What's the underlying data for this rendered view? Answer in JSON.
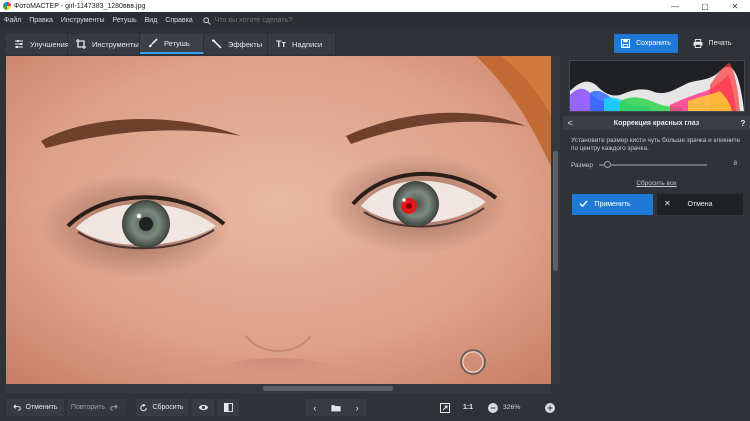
{
  "window": {
    "title": "ФотоМАСТЕР - girl-1147383_1280ввв.jpg",
    "controls": [
      "—",
      "▢",
      "✕"
    ]
  },
  "menu": {
    "items": [
      "Файл",
      "Правка",
      "Инструменты",
      "Ретушь",
      "Вид",
      "Справка"
    ],
    "search_placeholder": "Что вы хотите сделать?"
  },
  "tabs": [
    {
      "label": "Улучшения",
      "icon": "sliders-icon",
      "active": false
    },
    {
      "label": "Инструменты",
      "icon": "crop-icon",
      "active": false
    },
    {
      "label": "Ретушь",
      "icon": "brush-icon",
      "active": true
    },
    {
      "label": "Эффекты",
      "icon": "magic-wand-icon",
      "active": false
    },
    {
      "label": "Надписи",
      "icon": "text-icon",
      "active": false
    }
  ],
  "actions": {
    "save_label": "Сохранить",
    "print_label": "Печать"
  },
  "panel": {
    "title": "Коррекция красных глаз",
    "help": "?",
    "back": "<",
    "hint": "Установите размер кисти чуть больше зрачка и кликните по центру каждого зрачка.",
    "size_label": "Размер",
    "size_value": "8",
    "size_fraction": 0.05,
    "reset_label": "Сбросить все",
    "apply_label": "Применить",
    "cancel_label": "Отмена"
  },
  "bottom": {
    "undo_label": "Отменить",
    "redo_label": "Повторить",
    "reset_label": "Сбросить",
    "ratio_label": "1:1",
    "zoom_label": "326%"
  },
  "colors": {
    "accent": "#1f7ad6",
    "background": "#2f3237",
    "panel_dark": "#1f2125"
  }
}
